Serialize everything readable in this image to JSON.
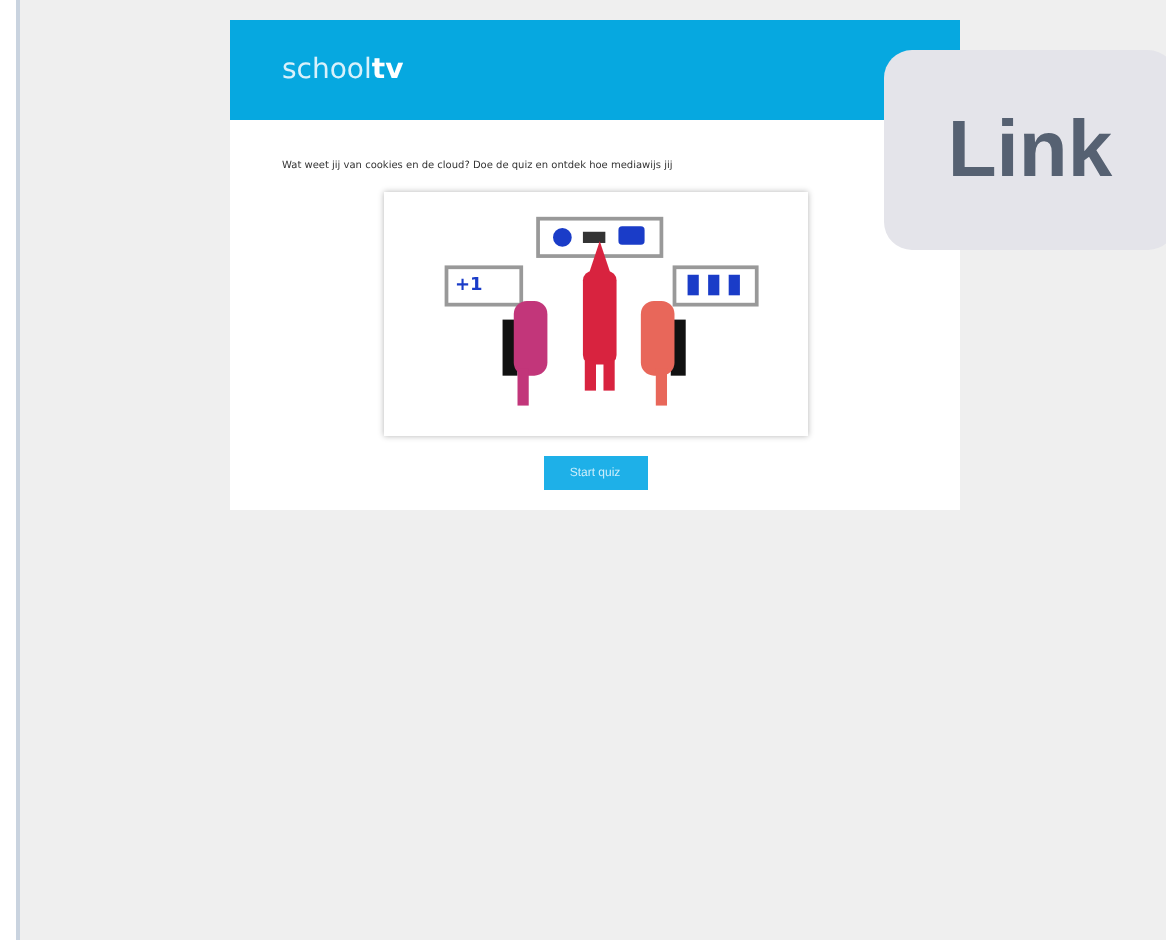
{
  "header": {
    "logo_light": "school",
    "logo_bold": "tv"
  },
  "intro": "Wat weet jij van cookies en de cloud? Doe de quiz en ontdek hoe mediawijs jij",
  "illustration": {
    "bubble_text": "+1"
  },
  "button": "Start quiz",
  "badge": "Link"
}
